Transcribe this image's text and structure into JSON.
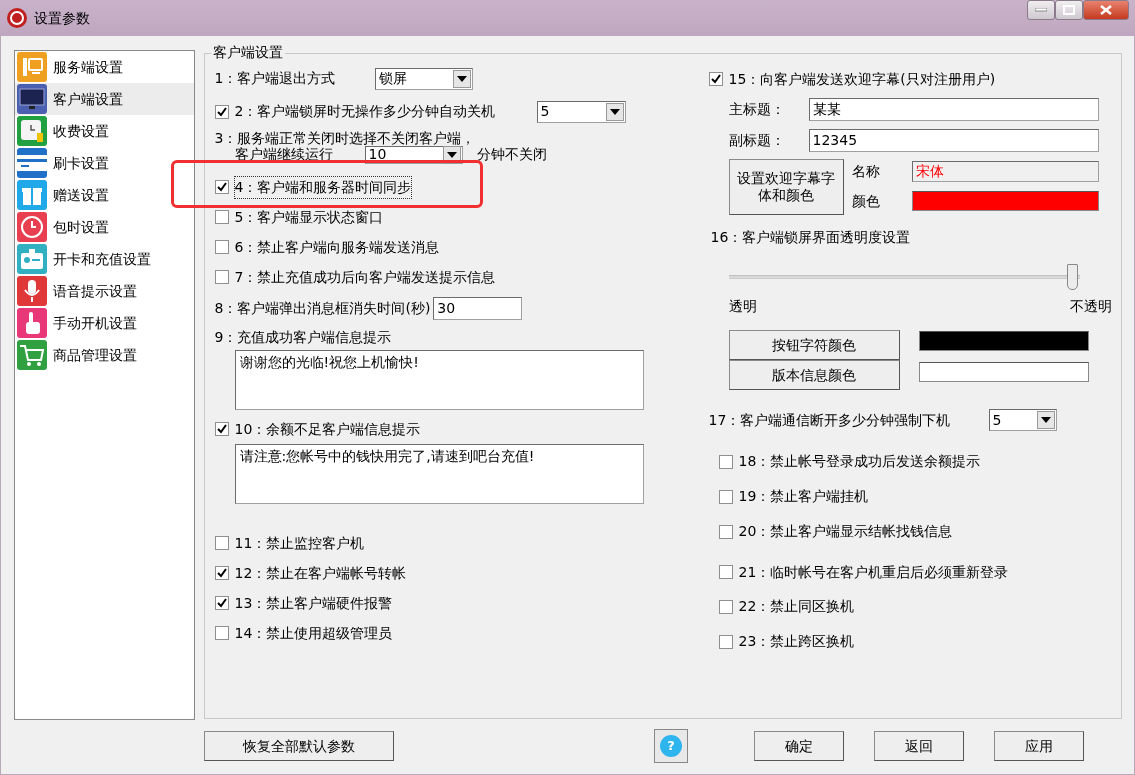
{
  "window": {
    "title": "设置参数"
  },
  "sidebar": {
    "items": [
      {
        "label": "服务端设置",
        "kind": "server",
        "color": "#f0a020",
        "selected": false
      },
      {
        "label": "客户端设置",
        "kind": "monitor",
        "color": "#4a5fb0",
        "selected": true
      },
      {
        "label": "收费设置",
        "kind": "clock-coins",
        "color": "#20a040",
        "selected": false
      },
      {
        "label": "刷卡设置",
        "kind": "card",
        "color": "#2070c8",
        "selected": false
      },
      {
        "label": "赠送设置",
        "kind": "gift",
        "color": "#20a8e8",
        "selected": false
      },
      {
        "label": "包时设置",
        "kind": "clock",
        "color": "#e84050",
        "selected": false
      },
      {
        "label": "开卡和充值设置",
        "kind": "badge",
        "color": "#30b0c0",
        "selected": false
      },
      {
        "label": "语音提示设置",
        "kind": "mic",
        "color": "#e03838",
        "selected": false
      },
      {
        "label": "手动开机设置",
        "kind": "hand",
        "color": "#e83878",
        "selected": false
      },
      {
        "label": "商品管理设置",
        "kind": "cart",
        "color": "#30a040",
        "selected": false
      }
    ]
  },
  "group": {
    "title": "客户端设置"
  },
  "left_options": [
    {
      "kind": "select",
      "label": "1：客户端退出方式",
      "value": "锁屏"
    },
    {
      "kind": "check-select",
      "label": "2：客户端锁屏时无操作多少分钟自动关机",
      "checked": true,
      "value": "5"
    },
    {
      "kind": "wrap-select",
      "label": "3：服务端正常关闭时选择不关闭客户端，",
      "label_2": "客户端继续运行",
      "value": "10",
      "suffix": "分钟不关闭"
    },
    {
      "kind": "check",
      "label": "4：客户端和服务器时间同步",
      "checked": true,
      "focused": true,
      "highlighted": true
    },
    {
      "kind": "check",
      "label": "5：客户端显示状态窗口",
      "checked": false
    },
    {
      "kind": "check",
      "label": "6：禁止客户端向服务端发送消息",
      "checked": false
    },
    {
      "kind": "check",
      "label": "7：禁止充值成功后向客户端发送提示信息",
      "checked": false
    },
    {
      "kind": "input",
      "label": "8：客户端弹出消息框消失时间(秒)",
      "value": "30"
    },
    {
      "kind": "textarea",
      "label": "9：充值成功客户端信息提示",
      "value": "谢谢您的光临!祝您上机愉快!"
    },
    {
      "kind": "check-textarea",
      "label": "10：余额不足客户端信息提示",
      "checked": true,
      "value": "请注意:您帐号中的钱快用完了,请速到吧台充值!"
    },
    {
      "kind": "check",
      "label": "11：禁止监控客户机",
      "checked": false
    },
    {
      "kind": "check",
      "label": "12：禁止在客户端帐号转帐",
      "checked": true
    },
    {
      "kind": "check",
      "label": "13：禁止客户端硬件报警",
      "checked": true
    },
    {
      "kind": "check",
      "label": "14：禁止使用超级管理员",
      "checked": false
    }
  ],
  "welcome": {
    "label": "15：向客户端发送欢迎字幕(只对注册用户)",
    "checked": true,
    "main_title_label": "主标题：",
    "main_title": "某某",
    "subtitle_label": "副标题：",
    "subtitle": "12345",
    "font_button": "设置欢迎字幕字体和颜色",
    "font_name_label": "名称",
    "font_name": "宋体",
    "color_label": "颜色",
    "color": "#ff0000"
  },
  "transparency": {
    "label": "16：客户端锁屏界面透明度设置",
    "level": 1,
    "min_label": "透明",
    "max_label": "不透明"
  },
  "color_buttons": [
    {
      "label": "按钮字符颜色",
      "color": "#000000"
    },
    {
      "label": "版本信息颜色",
      "color": "#ffffff"
    }
  ],
  "disconnect": {
    "label": "17：客户端通信断开多少分钟强制下机",
    "value": "5"
  },
  "right_checks": [
    {
      "label": "18：禁止帐号登录成功后发送余额提示",
      "checked": false
    },
    {
      "label": "19：禁止客户端挂机",
      "checked": false
    },
    {
      "label": "20：禁止客户端显示结帐找钱信息",
      "checked": false
    },
    {
      "label": "21：临时帐号在客户机重启后必须重新登录",
      "checked": false
    },
    {
      "label": "22：禁止同区换机",
      "checked": false
    },
    {
      "label": "23：禁止跨区换机",
      "checked": false
    }
  ],
  "footer": {
    "reset_button": "恢复全部默认参数",
    "help_button": "?",
    "buttons": [
      "确定",
      "返回",
      "应用"
    ]
  }
}
